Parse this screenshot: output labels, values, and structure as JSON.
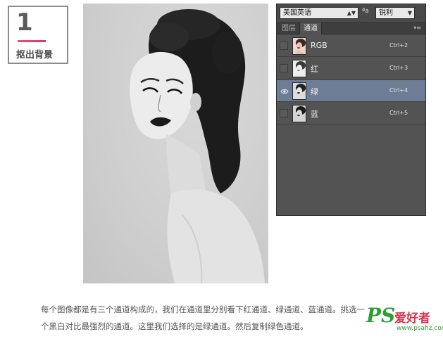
{
  "step": {
    "number": "1",
    "title": "抠出背景"
  },
  "panel": {
    "font_family_select": "美国英语",
    "aa_icon_label": "ªa",
    "aa_select": "锐利",
    "tabs": [
      {
        "label": "图层",
        "active": false
      },
      {
        "label": "通道",
        "active": true
      }
    ],
    "channels": [
      {
        "name": "RGB",
        "shortcut": "Ctrl+2",
        "visible": false,
        "selected": false
      },
      {
        "name": "红",
        "shortcut": "Ctrl+3",
        "visible": false,
        "selected": false
      },
      {
        "name": "绿",
        "shortcut": "Ctrl+4",
        "visible": true,
        "selected": true
      },
      {
        "name": "蓝",
        "shortcut": "Ctrl+5",
        "visible": false,
        "selected": false
      }
    ]
  },
  "caption": {
    "line1": "每个图像都是有三个通道构成的，我们在通道里分别看下红通道、绿通道、蓝通道。挑选一",
    "line2": "个黑白对比最强烈的通道。这里我们选择的是绿通道。然后复制绿色通道。"
  },
  "watermark": {
    "logo": "PS",
    "brand": "爱好者",
    "url": "www.psahz.com"
  },
  "colors": {
    "accent_line": "#d94a74",
    "panel_bg": "#535353",
    "selected_row": "#6d7d95",
    "watermark_green": "#2f9e36",
    "watermark_red": "#d6354e"
  }
}
